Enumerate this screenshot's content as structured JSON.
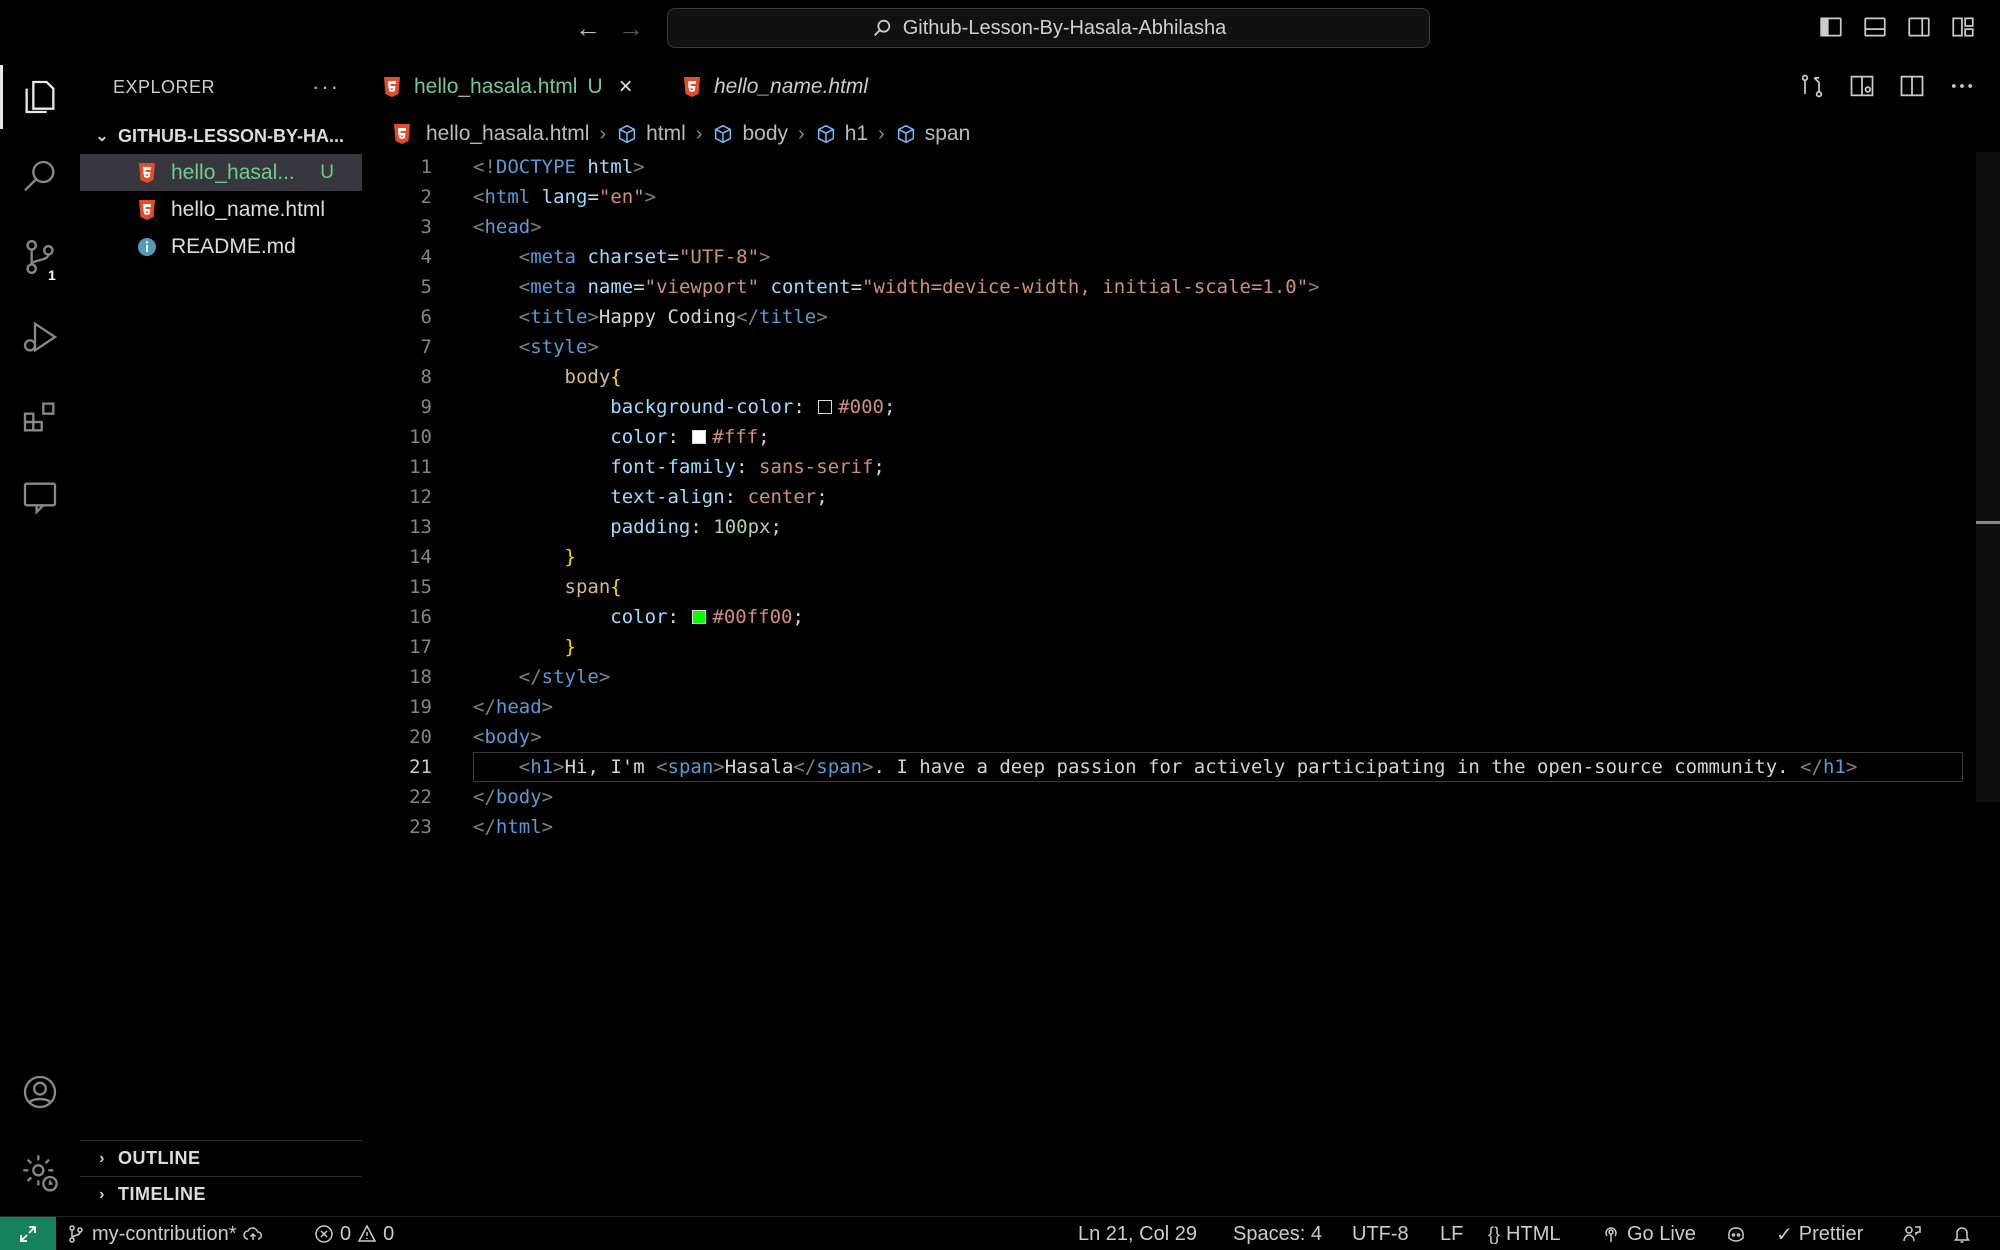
{
  "titlebar": {
    "title": "Github-Lesson-By-Hasala-Abhilasha"
  },
  "activity": {
    "scm_badge": "1"
  },
  "sidebar": {
    "title": "EXPLORER",
    "more": "···",
    "folder": "GITHUB-LESSON-BY-HA...",
    "files": [
      {
        "name": "hello_hasal...",
        "status": "U",
        "icon": "html5-icon"
      },
      {
        "name": "hello_name.html",
        "status": "",
        "icon": "html5-icon"
      },
      {
        "name": "README.md",
        "status": "",
        "icon": "info-icon"
      }
    ],
    "outline": "OUTLINE",
    "timeline": "TIMELINE"
  },
  "tabs": [
    {
      "label": "hello_hasala.html",
      "status": "U",
      "active": true
    },
    {
      "label": "hello_name.html",
      "status": "",
      "active": false
    }
  ],
  "breadcrumb": {
    "file": "hello_hasala.html",
    "items": [
      "html",
      "body",
      "h1",
      "span"
    ]
  },
  "editor": {
    "current_line": 21,
    "line_numbers": [
      "1",
      "2",
      "3",
      "4",
      "5",
      "6",
      "7",
      "8",
      "9",
      "10",
      "11",
      "12",
      "13",
      "14",
      "15",
      "16",
      "17",
      "18",
      "19",
      "20",
      "21",
      "22",
      "23"
    ]
  },
  "colors": {
    "swatch_bg": "#000",
    "swatch_fg": "#fff",
    "swatch_span": "#00ff00",
    "accent_green": "#73c991",
    "remote": "#16825d"
  },
  "statusbar": {
    "branch": "my-contribution*",
    "errors": "0",
    "warnings": "0",
    "position": "Ln 21, Col 29",
    "spaces": "Spaces: 4",
    "encoding": "UTF-8",
    "eol": "LF",
    "language": "HTML",
    "golive": "Go Live",
    "prettier": "Prettier"
  }
}
